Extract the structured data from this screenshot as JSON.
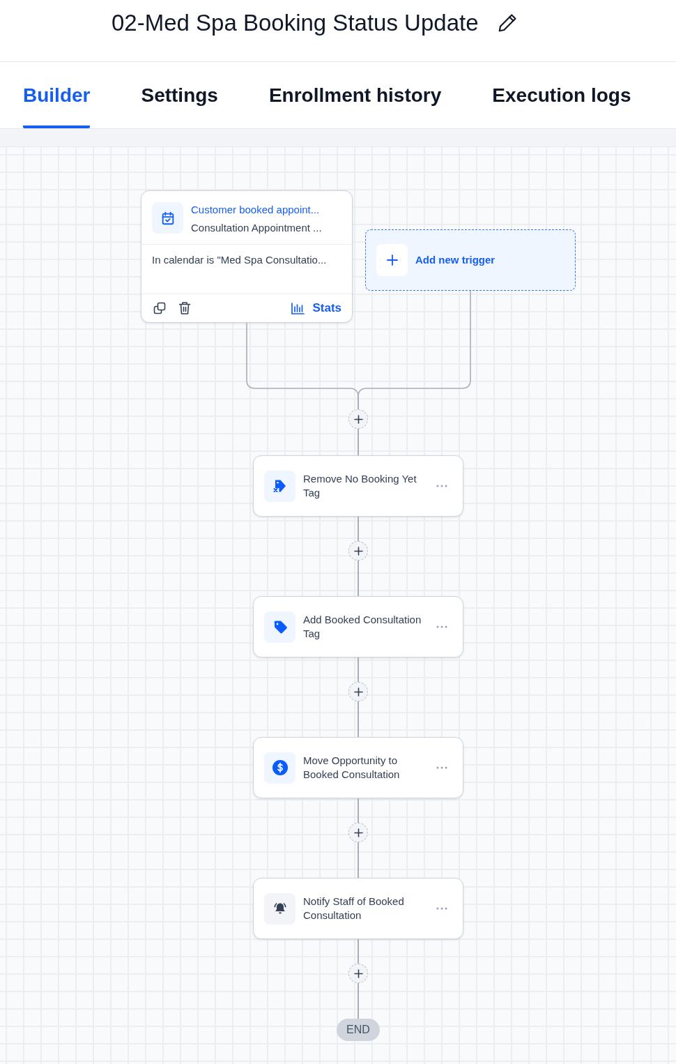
{
  "header": {
    "title": "02-Med Spa Booking Status Update"
  },
  "tabs": [
    {
      "label": "Builder",
      "selected": true
    },
    {
      "label": "Settings",
      "selected": false
    },
    {
      "label": "Enrollment history",
      "selected": false
    },
    {
      "label": "Execution logs",
      "selected": false
    }
  ],
  "trigger": {
    "title": "Customer booked appoint...",
    "subtitle": "Consultation Appointment ...",
    "condition": "In calendar is \"Med Spa Consultatio...",
    "stats_label": "Stats"
  },
  "add_trigger": {
    "label": "Add new trigger"
  },
  "actions": [
    {
      "kind": "untag",
      "label": "Remove No Booking Yet Tag"
    },
    {
      "kind": "tag",
      "label": "Add Booked Consultation Tag"
    },
    {
      "kind": "opportunity",
      "label": "Move Opportunity to Booked Consultation"
    },
    {
      "kind": "notify",
      "label": "Notify Staff of Booked Consultation"
    }
  ],
  "end": {
    "label": "END"
  }
}
